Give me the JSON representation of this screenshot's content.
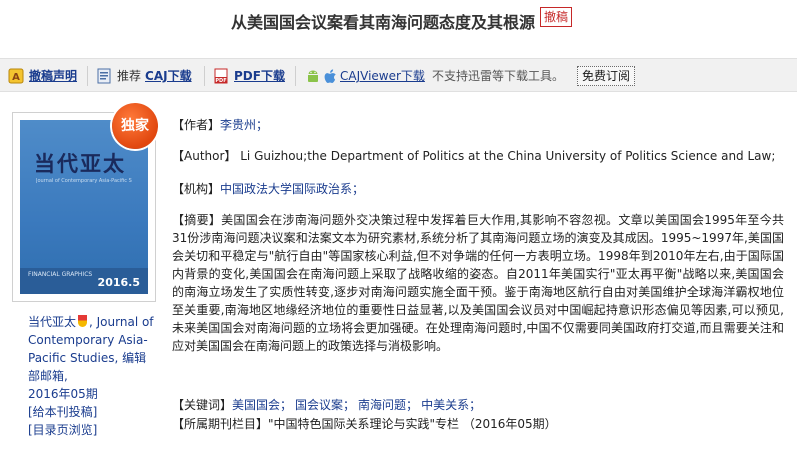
{
  "title": {
    "text": "从美国国会议案看其南海问题态度及其根源",
    "retract_badge": "撤稿"
  },
  "toolbar": {
    "retract_notice": "撤稿声明",
    "recommend": "推荐",
    "caj_download": "CAJ下载",
    "pdf_download": "PDF下载",
    "caj_viewer": "CAJViewer下载",
    "no_thunder": "不支持迅雷等下载工具。",
    "subscribe": "免费订阅"
  },
  "cover": {
    "badge": "独家",
    "title": "当代亚太",
    "subtitle": "Journal of Contemporary Asia-Pacific Studies",
    "issue": "2016.5",
    "label": "FINANCIAL GRAPHICS"
  },
  "journal": {
    "name_cn": "当代亚太",
    "name_en": ", Journal of Contemporary Asia-Pacific Studies, 编辑部邮箱,",
    "issue": "2016年05期",
    "links": [
      "[给本刊投稿]",
      "[目录页浏览]"
    ]
  },
  "meta": {
    "author_label": "【作者】",
    "author_value": "李贵州；",
    "author_en_label": "【Author】",
    "author_en_value": "Li Guizhou;the Department of Politics at the China University of Politics Science and Law;",
    "org_label": "【机构】",
    "org_value": "中国政法大学国际政治系；",
    "abstract_label": "【摘要】",
    "abstract_value": "美国国会在涉南海问题外交决策过程中发挥着巨大作用,其影响不容忽视。文章以美国国会1995年至今共31份涉南海问题决议案和法案文本为研究素材,系统分析了其南海问题立场的演变及其成因。1995~1997年,美国国会关切和平稳定与\"航行自由\"等国家核心利益,但不对争端的任何一方表明立场。1998年到2010年左右,由于国际国内背景的变化,美国国会在南海问题上采取了战略收缩的姿态。自2011年美国实行\"亚太再平衡\"战略以来,美国国会的南海立场发生了实质性转变,逐步对南海问题实施全面干预。鉴于南海地区航行自由对美国维护全球海洋霸权地位至关重要,南海地区地缘经济地位的重要性日益显著,以及美国国会议员对中国崛起持意识形态偏见等因素,可以预见,未来美国国会对南海问题的立场将会更加强硬。在处理南海问题时,中国不仅需要同美国政府打交道,而且需要关注和应对美国国会在南海问题上的政策选择与消极影响。",
    "keywords_label": "【关键词】",
    "keywords": [
      "美国国会；",
      "国会议案；",
      "南海问题；",
      "中美关系；"
    ],
    "column_label": "【所属期刊栏目】",
    "column_value": "\"中国特色国际关系理论与实践\"专栏 （2016年05期）"
  },
  "colors": {
    "link": "#1a3c8e",
    "retract": "#c62828",
    "toolbar_bg": "#f1f1f1",
    "badge_orange": "#e1470f",
    "cover_blue": "#3a79bd"
  },
  "icons": [
    "retract-notice-icon",
    "caj-icon",
    "pdf-icon",
    "android-icon",
    "apple-icon"
  ]
}
